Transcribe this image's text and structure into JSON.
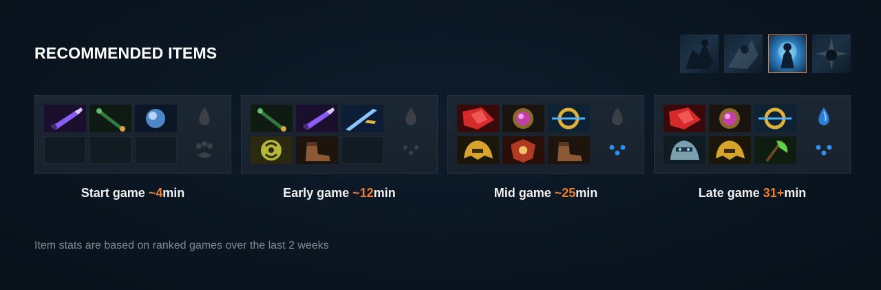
{
  "section": {
    "title": "RECOMMENDED ITEMS"
  },
  "abilities": [
    {
      "name": "ability-1",
      "selected": false
    },
    {
      "name": "ability-2",
      "selected": false
    },
    {
      "name": "ability-3",
      "selected": true
    },
    {
      "name": "ability-4",
      "selected": false
    }
  ],
  "stages": [
    {
      "label": "Start game ",
      "duration": "~4",
      "unit": "min",
      "items": [
        "purple-dagger-icon",
        "green-wand-icon",
        "blue-orb-icon",
        "empty",
        "empty",
        "empty"
      ],
      "neutral": [
        "dark-drop-icon",
        "dark-paw-icon"
      ]
    },
    {
      "label": "Early game ",
      "duration": "~12",
      "unit": "min",
      "items": [
        "green-wand-icon",
        "purple-dagger-icon",
        "blue-sword-icon",
        "yellow-rune-icon",
        "brown-boots-icon",
        "empty"
      ],
      "neutral": [
        "dark-drop-icon",
        "dark-dots-icon"
      ]
    },
    {
      "label": "Mid game ",
      "duration": "~25",
      "unit": "min",
      "items": [
        "red-gem-icon",
        "pink-orb-icon",
        "golden-ring-icon",
        "golden-helm-icon",
        "red-shield-icon",
        "brown-boots-icon"
      ],
      "neutral": [
        "dark-drop-icon",
        "blue-dots-icon"
      ]
    },
    {
      "label": "Late game ",
      "duration": "31+",
      "unit": "min",
      "items": [
        "red-gem-icon",
        "pink-orb-icon",
        "golden-ring-icon",
        "steel-helm-icon",
        "golden-helm-icon",
        "green-axe-icon"
      ],
      "neutral": [
        "blue-drop-icon",
        "blue-dots-icon"
      ]
    }
  ],
  "footer": {
    "note": "Item stats are based on ranked games over the last 2 weeks"
  },
  "colors": {
    "accent": "#ef7d33",
    "background": "#0a1520",
    "panel": "#1b2733",
    "muted": "#7d8a96"
  }
}
